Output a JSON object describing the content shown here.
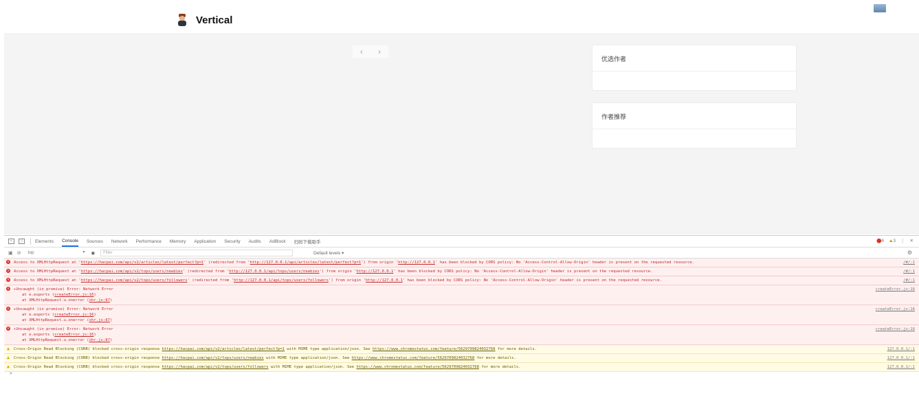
{
  "header": {
    "site_title": "Vertical"
  },
  "pager": {
    "prev": "‹",
    "next": "›"
  },
  "cards": [
    {
      "title": "优选作者"
    },
    {
      "title": "作者推荐"
    }
  ],
  "devtools": {
    "tabs": [
      "Elements",
      "Console",
      "Sources",
      "Network",
      "Performance",
      "Memory",
      "Application",
      "Security",
      "Audits",
      "AdBlock",
      "扫码下载助手"
    ],
    "active_tab": "Console",
    "error_count": "6",
    "warn_count": "3",
    "context": "top",
    "filter_placeholder": "Filter",
    "levels": "Default levels ▾",
    "logs": {
      "cors1": {
        "pre": "Access to XMLHttpRequest at '",
        "url": "https://hacpai.com/api/v2/articles/latest/perfect?p=1",
        "mid": "' (redirected from '",
        "redir": "http://127.0.0.1/api/articles/latest/perfect?p=1",
        "mid2": "') from origin '",
        "origin": "http://127.0.0.1",
        "post": "' has been blocked by CORS policy: No 'Access-Control-Allow-Origin' header is present on the requested resource.",
        "src": "/#/:1"
      },
      "cors2": {
        "pre": "Access to XMLHttpRequest at '",
        "url": "https://hacpai.com/api/v2/tops/users/newbies",
        "mid": "' (redirected from '",
        "redir": "http://127.0.0.1/api/tops/users/newbies",
        "mid2": "') from origin '",
        "origin": "http://127.0.0.1",
        "post": "' has been blocked by CORS policy: No 'Access-Control-Allow-Origin' header is present on the requested resource.",
        "src": "/#/:1"
      },
      "cors3": {
        "pre": "Access to XMLHttpRequest at '",
        "url": "https://hacpai.com/api/v2/tops/users/followers",
        "mid": "' (redirected from '",
        "redir": "http://127.0.0.1/api/tops/users/followers",
        "mid2": "') from origin '",
        "origin": "http://127.0.0.1",
        "post": "' has been blocked by CORS policy: No 'Access-Control-Allow-Origin' header is present on the requested resource.",
        "src": "/#/:1"
      },
      "uncaught": {
        "line1": "▸Uncaught (in promise) Error: Network Error",
        "line2": "at e.exports (",
        "line2_link": "createError.js:16",
        "line2_end": ")",
        "line3": "at XMLHttpRequest.u.onerror (",
        "line3_link": "xhr.js:87",
        "line3_end": ")",
        "src": "createError.js:16"
      },
      "corb1": {
        "pre": "Cross-Origin Read Blocking (CORB) blocked cross-origin response ",
        "url": "https://hacpai.com/api/v2/articles/latest/perfect?p=1",
        "mid": " with MIME type application/json. See ",
        "link": "https://www.chromestatus.com/feature/5629709824032768",
        "post": " for more details.",
        "src": "127.0.0.1/:1"
      },
      "corb2": {
        "pre": "Cross-Origin Read Blocking (CORB) blocked cross-origin response ",
        "url": "https://hacpai.com/api/v2/tops/users/newbies",
        "mid": " with MIME type application/json. See ",
        "link": "https://www.chromestatus.com/feature/5629709824032768",
        "post": " for more details.",
        "src": "127.0.0.1/:1"
      },
      "corb3": {
        "pre": "Cross-Origin Read Blocking (CORB) blocked cross-origin response ",
        "url": "https://hacpai.com/api/v2/tops/users/followers",
        "mid": " with MIME type application/json. See ",
        "link": "https://www.chromestatus.com/feature/5629709824032768",
        "post": " for more details.",
        "src": "127.0.0.1/:1"
      }
    },
    "prompt": ">"
  }
}
